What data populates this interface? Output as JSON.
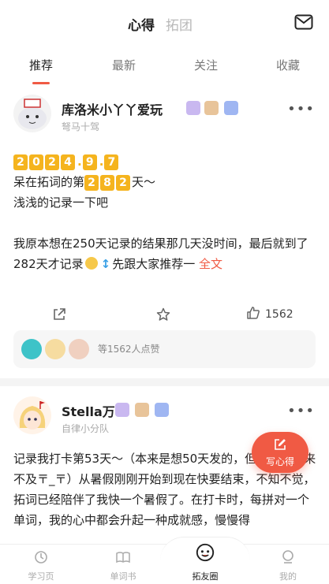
{
  "header": {
    "seg_active": "心得",
    "seg_inactive": "拓团",
    "mail_icon": "mail-icon"
  },
  "tabs": [
    {
      "label": "推荐"
    },
    {
      "label": "最新"
    },
    {
      "label": "关注"
    },
    {
      "label": "收藏"
    }
  ],
  "posts": [
    {
      "author": "库洛米小丫丫爱玩",
      "subtitle": "弩马十驾",
      "date_digits": [
        "2",
        "0",
        "2",
        "4",
        "9",
        "7"
      ],
      "line2_pre": "呆在拓词的第",
      "day_digits": [
        "2",
        "8",
        "2"
      ],
      "line2_post": "天～",
      "line3": "浅浅的记录一下吧",
      "para": "我原本想在250天记录的结果那几天没时间，最后就到了282天才记录",
      "para_tail": "先跟大家推荐一",
      "more_link": "全文",
      "like_count": "1562",
      "likers_text": "等1562人点赞"
    },
    {
      "author": "Stella万",
      "subtitle": "自律小分队",
      "text": "记录我打卡第53天～（本来是想50天发的，但那两天都来不及〒_〒）从暑假刚刚开始到现在快要结束，不知不觉，拓词已经陪伴了我快一个暑假了。在打卡时，每拼对一个单词，我的心中都会升起一种成就感，慢慢得"
    }
  ],
  "fab": {
    "label": "写心得"
  },
  "bottom_nav": [
    {
      "label": "学习页"
    },
    {
      "label": "单词书"
    },
    {
      "label": "拓友圈"
    },
    {
      "label": "我的"
    }
  ],
  "colors": {
    "accent": "#f05a44",
    "date_box": "#f5b41e"
  }
}
